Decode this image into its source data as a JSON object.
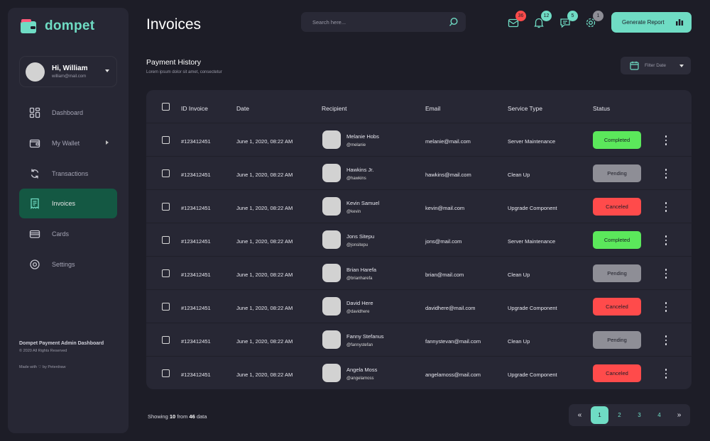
{
  "brand": {
    "name": "dompet",
    "accent": "#6fdcc4"
  },
  "user": {
    "name": "Hi, William",
    "email": "william@mail.com"
  },
  "nav": [
    {
      "label": "Dashboard",
      "icon": "dashboard-icon",
      "active": false
    },
    {
      "label": "My Wallet",
      "icon": "wallet-icon",
      "active": false
    },
    {
      "label": "Transactions",
      "icon": "transactions-icon",
      "active": false
    },
    {
      "label": "Invoices",
      "icon": "invoice-icon",
      "active": true
    },
    {
      "label": "Cards",
      "icon": "card-icon",
      "active": false
    },
    {
      "label": "Settings",
      "icon": "settings-icon",
      "active": false
    }
  ],
  "sidebar_footer": {
    "title": "Dompet Payment Admin Dashboard",
    "copyright": "© 2020 All Rights Reserved",
    "made_with": "Made with ♡ by Peterdraw"
  },
  "header": {
    "title": "Invoices",
    "search_placeholder": "Search here...",
    "badges": {
      "mail": "36",
      "bell": "12",
      "chat": "5",
      "settings": "1"
    },
    "generate_label": "Generate Report"
  },
  "payment_history": {
    "title": "Payment History",
    "subtitle": "Lorem ipsum dolor sit amet, consectetur",
    "filter_label": "Filter Date"
  },
  "table": {
    "columns": [
      "ID Invoice",
      "Date",
      "Recipient",
      "Email",
      "Service Type",
      "Status"
    ],
    "rows": [
      {
        "id": "#123412451",
        "date": "June 1, 2020, 08:22 AM",
        "name": "Melanie Hobs",
        "handle": "@melanie",
        "email": "melanie@mail.com",
        "service": "Server Maintenance",
        "status": "Completed"
      },
      {
        "id": "#123412451",
        "date": "June 1, 2020, 08:22 AM",
        "name": "Hawkins Jr.",
        "handle": "@hawkins",
        "email": "hawkins@mail.com",
        "service": "Clean Up",
        "status": "Pending"
      },
      {
        "id": "#123412451",
        "date": "June 1, 2020, 08:22 AM",
        "name": "Kevin Samuel",
        "handle": "@kevin",
        "email": "kevin@mail.com",
        "service": "Upgrade Component",
        "status": "Canceled"
      },
      {
        "id": "#123412451",
        "date": "June 1, 2020, 08:22 AM",
        "name": "Jons Sitepu",
        "handle": "@jonsitepu",
        "email": "jons@mail.com",
        "service": "Server Maintenance",
        "status": "Completed"
      },
      {
        "id": "#123412451",
        "date": "June 1, 2020, 08:22 AM",
        "name": "Brian Harefa",
        "handle": "@brianharefa",
        "email": "brian@mail.com",
        "service": "Clean Up",
        "status": "Pending"
      },
      {
        "id": "#123412451",
        "date": "June 1, 2020, 08:22 AM",
        "name": "David Here",
        "handle": "@davidhere",
        "email": "davidhere@mail.com",
        "service": "Upgrade Component",
        "status": "Canceled"
      },
      {
        "id": "#123412451",
        "date": "June 1, 2020, 08:22 AM",
        "name": "Fanny Stefanus",
        "handle": "@fannystefan",
        "email": "fannystevan@mail.com",
        "service": "Clean Up",
        "status": "Pending"
      },
      {
        "id": "#123412451",
        "date": "June 1, 2020, 08:22 AM",
        "name": "Angela Moss",
        "handle": "@angelamoss",
        "email": "angelamoss@mail.com",
        "service": "Upgrade Component",
        "status": "Canceled"
      }
    ]
  },
  "status_colors": {
    "Completed": "#5be85b",
    "Pending": "#8e8e96",
    "Canceled": "#ff4b4b"
  },
  "badge_colors": {
    "mail": "#ff4b4b",
    "bell": "#6fdcc4",
    "chat": "#6fdcc4",
    "settings": "#8e8e96"
  },
  "footer": {
    "showing_prefix": "Showing",
    "showing_count": "10",
    "showing_mid": "from",
    "showing_total": "46",
    "showing_suffix": "data"
  },
  "pagination": {
    "first": "«",
    "pages": [
      "1",
      "2",
      "3",
      "4"
    ],
    "current": "1",
    "last": "»"
  }
}
